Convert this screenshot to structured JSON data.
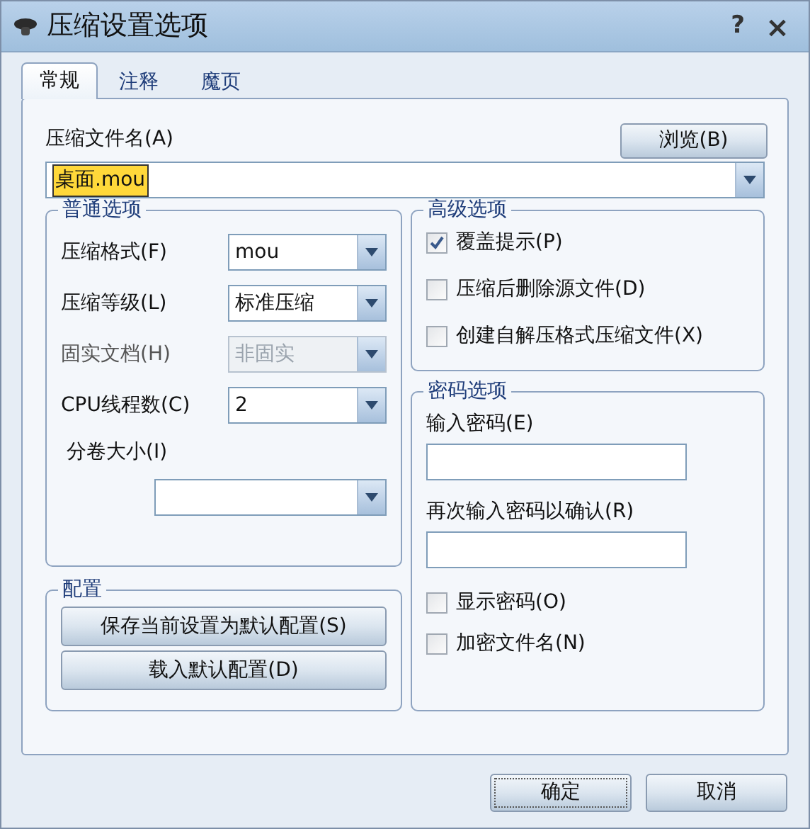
{
  "window": {
    "title": "压缩设置选项",
    "help": "?",
    "close": "×"
  },
  "tabs": [
    {
      "label": "常规",
      "selected": true
    },
    {
      "label": "注释",
      "selected": false
    },
    {
      "label": "魔页",
      "selected": false
    }
  ],
  "archive_name": {
    "label": "压缩文件名(A)",
    "browse_button": "浏览(B)",
    "value": "桌面.mou",
    "selected": true
  },
  "general_options": {
    "title": "普通选项",
    "fields": [
      {
        "kind": "inline",
        "label": "压缩格式(F)",
        "value": "mou",
        "disabled": false
      },
      {
        "kind": "inline",
        "label": "压缩等级(L)",
        "value": "标准压缩",
        "disabled": false
      },
      {
        "kind": "inline",
        "label": "固实文档(H)",
        "value": "非固实",
        "disabled": true
      },
      {
        "kind": "inline",
        "label": "CPU线程数(C)",
        "value": "2",
        "disabled": false
      },
      {
        "kind": "stacked",
        "label": "分卷大小(I)",
        "disabled": false
      }
    ]
  },
  "advanced_options": {
    "title": "高级选项",
    "checkboxes": [
      {
        "label": "覆盖提示(P)",
        "checked": true
      },
      {
        "label": "压缩后删除源文件(D)",
        "checked": false
      },
      {
        "label": "创建自解压格式压缩文件(X)",
        "checked": false
      }
    ]
  },
  "password_options": {
    "title": "密码选项",
    "fields": [
      {
        "label": "输入密码(E)"
      },
      {
        "label": "再次输入密码以确认(R)"
      }
    ],
    "checkboxes": [
      {
        "label": "显示密码(O)",
        "checked": false
      },
      {
        "label": "加密文件名(N)",
        "checked": false
      }
    ]
  },
  "profile": {
    "title": "配置",
    "buttons": [
      "保存当前设置为默认配置(S)",
      "载入默认配置(D)"
    ]
  },
  "buttons": [
    {
      "label": "确定",
      "default": true
    },
    {
      "label": "取消",
      "default": false
    }
  ]
}
